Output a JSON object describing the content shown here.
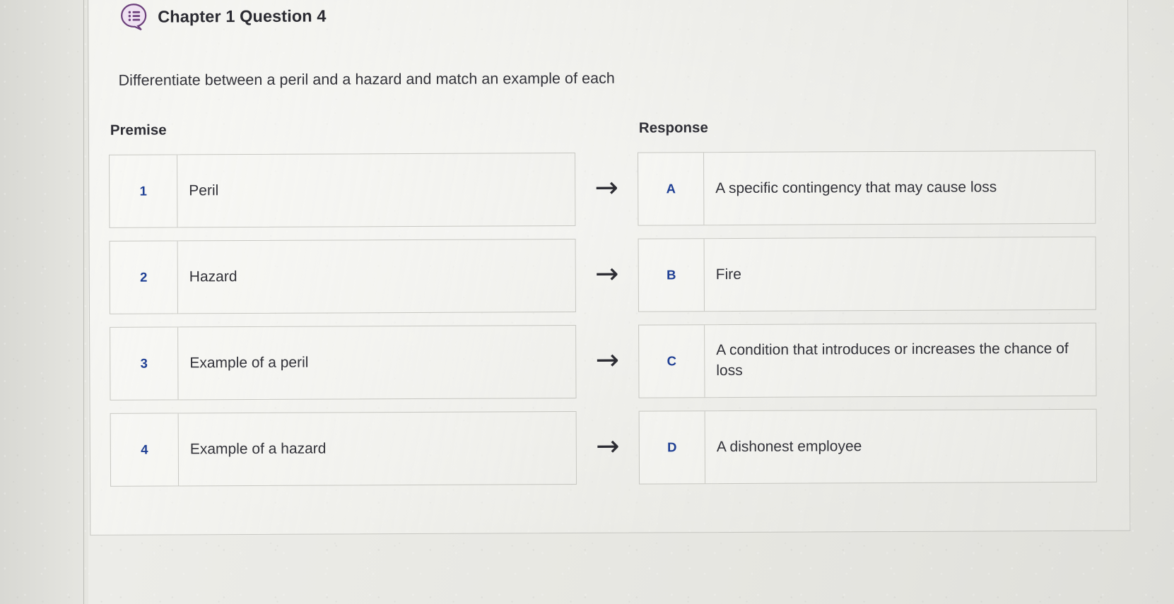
{
  "header": {
    "icon": "question-bubble-icon",
    "title": "Chapter 1 Question 4"
  },
  "prompt": "Differentiate between a peril and a hazard and match an example of each",
  "columns": {
    "premise_heading": "Premise",
    "response_heading": "Response"
  },
  "arrow_glyph": "→",
  "premises": [
    {
      "key": "1",
      "text": "Peril"
    },
    {
      "key": "2",
      "text": "Hazard"
    },
    {
      "key": "3",
      "text": "Example of a peril"
    },
    {
      "key": "4",
      "text": "Example of a hazard"
    }
  ],
  "responses": [
    {
      "key": "A",
      "text": "A specific contingency that may cause loss"
    },
    {
      "key": "B",
      "text": "Fire"
    },
    {
      "key": "C",
      "text": "A condition that introduces or increases the chance of loss"
    },
    {
      "key": "D",
      "text": "A dishonest employee"
    }
  ],
  "colors": {
    "key_blue": "#1f3f94",
    "icon_purple": "#6b3f7a",
    "text_dark": "#33333a",
    "page_background": "#e8e8e3"
  }
}
